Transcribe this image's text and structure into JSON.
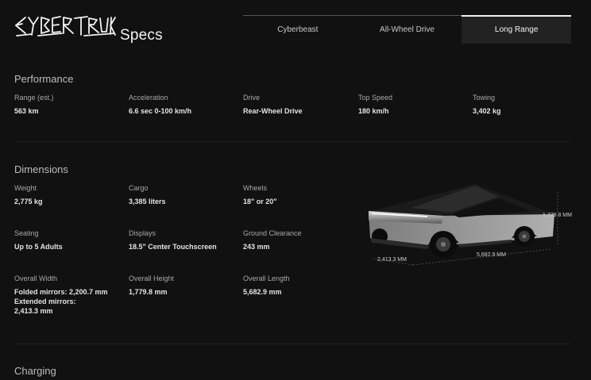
{
  "header": {
    "specs_label": "Specs",
    "tabs": [
      {
        "label": "Cyberbeast",
        "active": false
      },
      {
        "label": "All-Wheel Drive",
        "active": false
      },
      {
        "label": "Long Range",
        "active": true
      }
    ]
  },
  "performance": {
    "title": "Performance",
    "fields": [
      {
        "label": "Range (est.)",
        "value": "563 km"
      },
      {
        "label": "Acceleration",
        "value": "6.6 sec 0-100 km/h"
      },
      {
        "label": "Drive",
        "value": "Rear-Wheel Drive"
      },
      {
        "label": "Top Speed",
        "value": "180 km/h"
      },
      {
        "label": "Towing",
        "value": "3,402 kg"
      }
    ]
  },
  "dimensions": {
    "title": "Dimensions",
    "fields": [
      {
        "label": "Weight",
        "value": "2,775 kg"
      },
      {
        "label": "Cargo",
        "value": "3,385 liters"
      },
      {
        "label": "Wheels",
        "value": "18\" or 20\""
      },
      {
        "label": "Seating",
        "value": "Up to 5 Adults"
      },
      {
        "label": "Displays",
        "value": "18.5\" Center Touchscreen"
      },
      {
        "label": "Ground Clearance",
        "value": "243 mm"
      },
      {
        "label": "Overall Width",
        "value": "Folded mirrors: 2,200.7 mm\nExtended mirrors:\n2,413.3 mm"
      },
      {
        "label": "Overall Height",
        "value": "1,779.8 mm"
      },
      {
        "label": "Overall Length",
        "value": "5,682.9 mm"
      }
    ],
    "diagram": {
      "height_label": "1,779.8 MM",
      "width_label": "2,413.3 MM",
      "length_label": "5,682.9 MM"
    }
  },
  "charging": {
    "title": "Charging"
  },
  "colors": {
    "background": "#111111",
    "active_tab": "#222222"
  }
}
